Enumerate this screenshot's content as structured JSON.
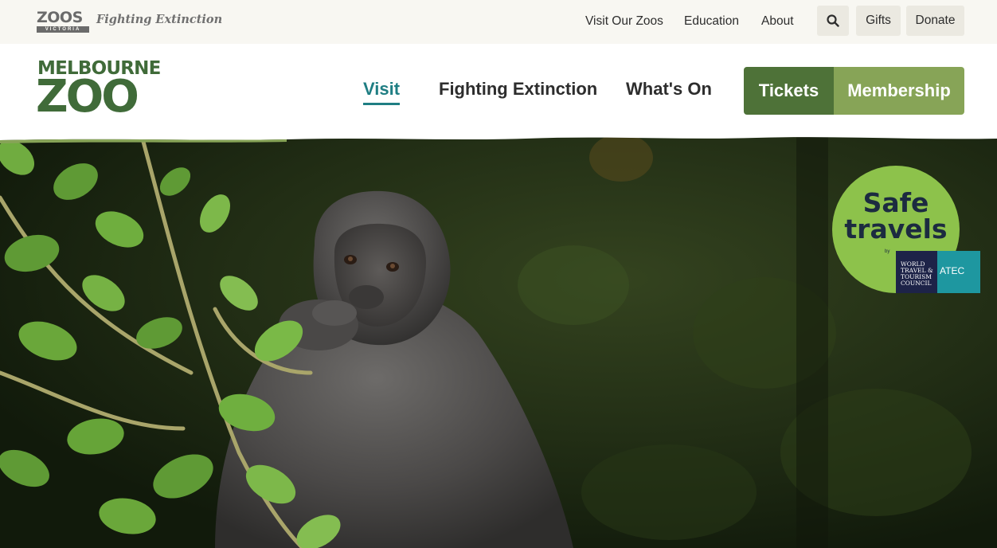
{
  "utility_bar": {
    "org_logo": {
      "word": "ZOOS",
      "sub": "VICTORIA"
    },
    "tagline": "Fighting Extinction",
    "links": [
      "Visit Our Zoos",
      "Education",
      "About"
    ],
    "search_icon": "search-icon",
    "gifts_label": "Gifts",
    "donate_label": "Donate"
  },
  "header": {
    "logo_top": "MELBOURNE",
    "logo_bottom": "ZOO",
    "nav": [
      {
        "label": "Visit",
        "active": true
      },
      {
        "label": "Fighting Extinction",
        "active": false
      },
      {
        "label": "What's On",
        "active": false
      }
    ],
    "tickets_label": "Tickets",
    "membership_label": "Membership"
  },
  "badge": {
    "title_line1": "Safe",
    "title_line2": "travels",
    "by": "by",
    "partner1": "WORLD TRAVEL & TOURISM COUNCIL",
    "partner2": "ATEC"
  },
  "colors": {
    "accent_teal": "#1f7e83",
    "brand_green_dark": "#4e7238",
    "brand_green_light": "#87a457",
    "utility_bg": "#f8f7f2",
    "badge_green": "#8dc24b"
  }
}
